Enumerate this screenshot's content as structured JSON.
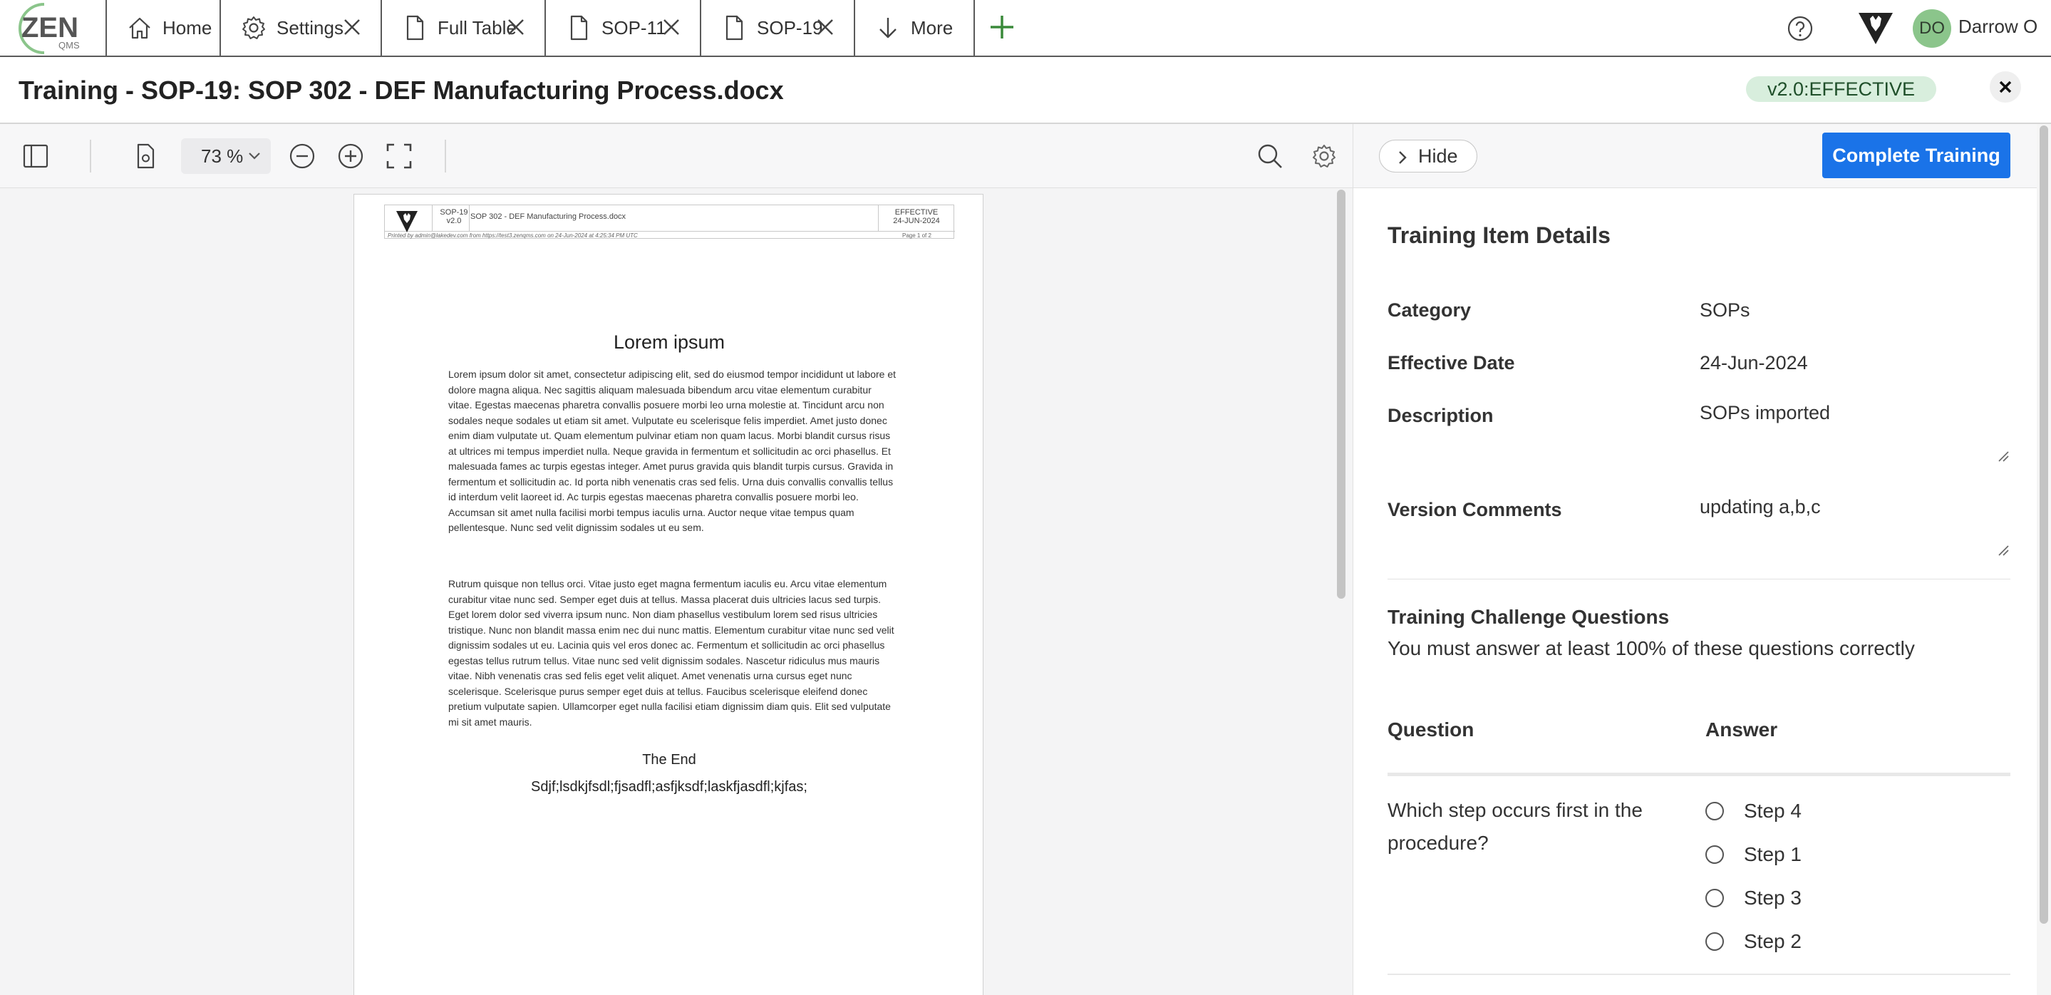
{
  "topbar": {
    "logo_text": "ZEN",
    "logo_sub": "QMS",
    "tabs": [
      {
        "label": "Home",
        "icon": "home-icon",
        "closable": false
      },
      {
        "label": "Settings",
        "icon": "gear-icon",
        "closable": true
      },
      {
        "label": "Full Table",
        "icon": "document-icon",
        "closable": true
      },
      {
        "label": "SOP-11",
        "icon": "document-icon",
        "closable": true
      },
      {
        "label": "SOP-19",
        "icon": "document-icon",
        "closable": true
      },
      {
        "label": "More",
        "icon": "arrow-down-icon",
        "closable": false
      }
    ],
    "user_initials": "DO",
    "user_name": "Darrow O"
  },
  "title_row": {
    "title": "Training - SOP-19: SOP 302 - DEF Manufacturing Process.docx",
    "status": "v2.0:EFFECTIVE"
  },
  "viewer": {
    "zoom": "73 %"
  },
  "document": {
    "header": {
      "doc_id": "SOP-19",
      "version": "v2.0",
      "name": "SOP 302 - DEF Manufacturing Process.docx",
      "status": "EFFECTIVE",
      "date": "24-JUN-2024",
      "printed": "Printed by admin@lakedev.com from https://test3.zenqms.com on 24-Jun-2024 at 4:25:34 PM UTC",
      "pages": "Page 1 of 2"
    },
    "heading": "Lorem ipsum",
    "paragraph_1": "Lorem ipsum dolor sit amet, consectetur adipiscing elit, sed do eiusmod tempor incididunt ut labore et dolore magna aliqua. Nec sagittis aliquam malesuada bibendum arcu vitae elementum curabitur vitae. Egestas maecenas pharetra convallis posuere morbi leo urna molestie at. Tincidunt arcu non sodales neque sodales ut etiam sit amet. Vulputate eu scelerisque felis imperdiet. Amet justo donec enim diam vulputate ut. Quam elementum pulvinar etiam non quam lacus. Morbi blandit cursus risus at ultrices mi tempus imperdiet nulla. Neque gravida in fermentum et sollicitudin ac orci phasellus. Et malesuada fames ac turpis egestas integer. Amet purus gravida quis blandit turpis cursus. Gravida in fermentum et sollicitudin ac. Id porta nibh venenatis cras sed felis. Urna duis convallis convallis tellus id interdum velit laoreet id. Ac turpis egestas maecenas pharetra convallis posuere morbi leo. Accumsan sit amet nulla facilisi morbi tempus iaculis urna. Auctor neque vitae tempus quam pellentesque. Nunc sed velit dignissim sodales ut eu sem.",
    "paragraph_2": "Rutrum quisque non tellus orci. Vitae justo eget magna fermentum iaculis eu. Arcu vitae elementum curabitur vitae nunc sed. Semper eget duis at tellus. Massa placerat duis ultricies lacus sed turpis. Eget lorem dolor sed viverra ipsum nunc. Non diam phasellus vestibulum lorem sed risus ultricies tristique. Nunc non blandit massa enim nec dui nunc mattis. Elementum curabitur vitae nunc sed velit dignissim sodales ut eu. Lacinia quis vel eros donec ac. Fermentum et sollicitudin ac orci phasellus egestas tellus rutrum tellus. Vitae nunc sed velit dignissim sodales. Nascetur ridiculus mus mauris vitae. Nibh venenatis cras sed felis eget velit aliquet. Amet venenatis urna cursus eget nunc scelerisque. Scelerisque purus semper eget duis at tellus. Faucibus scelerisque eleifend donec pretium vulputate sapien. Ullamcorper eget nulla facilisi etiam dignissim diam quis. Elit sed vulputate mi sit amet mauris.",
    "end_text": "The End",
    "last_line": "Sdjf;lsdkjfsdl;fjsadfl;asfjksdf;laskfjasdfl;kjfas;"
  },
  "panel": {
    "hide_label": "Hide",
    "complete_label": "Complete Training",
    "details_title": "Training Item Details",
    "fields": [
      {
        "label": "Category",
        "value": "SOPs"
      },
      {
        "label": "Effective Date",
        "value": "24-Jun-2024"
      },
      {
        "label": "Description",
        "value": "SOPs imported"
      },
      {
        "label": "Version Comments",
        "value": "updating a,b,c"
      }
    ],
    "challenge_title": "Training Challenge Questions",
    "challenge_subtitle": "You must answer at least 100% of these questions correctly",
    "col_question": "Question",
    "col_answer": "Answer",
    "questions": [
      {
        "text": "Which step occurs first in the procedure?",
        "options": [
          "Step 4",
          "Step 1",
          "Step 3",
          "Step 2"
        ]
      }
    ]
  },
  "colors": {
    "accent": "#1a73e8",
    "badge_bg": "#d8eedd",
    "avatar_bg": "#8bc58b",
    "add_tab": "#3a8a3a"
  }
}
